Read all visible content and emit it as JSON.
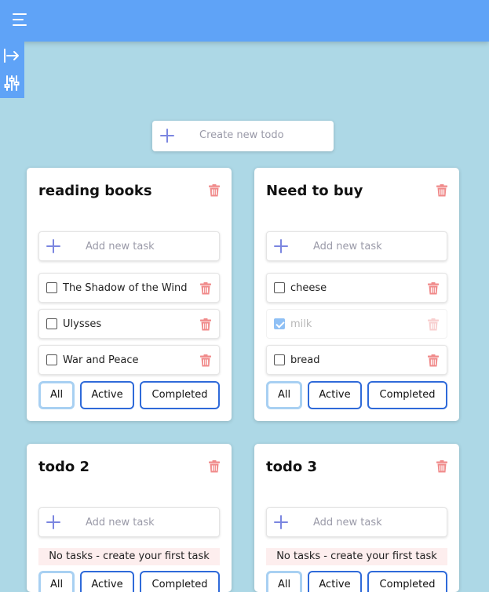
{
  "header": {
    "menu_icon": "hamburger-menu-icon"
  },
  "sidebar": {
    "items": [
      {
        "icon": "arrow-right-bar-icon"
      },
      {
        "icon": "sliders-icon"
      }
    ]
  },
  "create": {
    "placeholder": "Create new todo"
  },
  "colors": {
    "header": "#5fa3f7",
    "background": "#add8e6",
    "accent": "#2f6ad9",
    "delete": "#f08a8a",
    "empty_bg": "#fdeeee"
  },
  "filters": [
    "All",
    "Active",
    "Completed"
  ],
  "lists": [
    {
      "title": "reading books",
      "add_placeholder": "Add new task",
      "tasks": [
        {
          "text": "The Shadow of the Wind",
          "done": false
        },
        {
          "text": "Ulysses",
          "done": false
        },
        {
          "text": "War and Peace",
          "done": false
        }
      ],
      "active_filter": "All"
    },
    {
      "title": "Need to buy",
      "add_placeholder": "Add new task",
      "tasks": [
        {
          "text": "cheese",
          "done": false
        },
        {
          "text": "milk",
          "done": true
        },
        {
          "text": "bread",
          "done": false
        }
      ],
      "active_filter": "All"
    },
    {
      "title": "todo 2",
      "add_placeholder": "Add new task",
      "empty_text": "No tasks - create your first task",
      "active_filter": "All"
    },
    {
      "title": "todo 3",
      "add_placeholder": "Add new task",
      "empty_text": "No tasks - create your first task",
      "active_filter": "All"
    }
  ]
}
